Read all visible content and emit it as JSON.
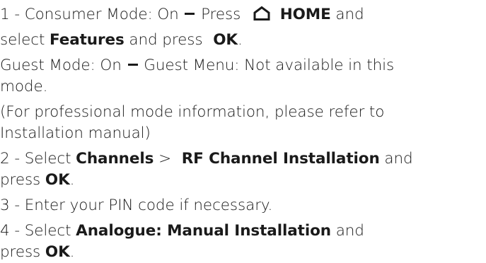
{
  "doc": {
    "l1": {
      "a": "1 - Consumer Mode: On",
      "b": "Press",
      "icon": "home-icon",
      "c": "HOME",
      "d": "and"
    },
    "l2": {
      "a": "select",
      "b": "Features",
      "c": "and press",
      "d": "OK",
      "e": "."
    },
    "l3": {
      "a": "Guest Mode: On",
      "b": "Guest Menu: Not available in this"
    },
    "l4": {
      "a": "mode."
    },
    "l5": {
      "a": "(For professional mode information, please refer to"
    },
    "l6": {
      "a": "Installation manual)"
    },
    "l7": {
      "a": "2 - Select",
      "b": "Channels",
      "c": ">",
      "d": "RF Channel Installation",
      "e": "and"
    },
    "l8": {
      "a": "press",
      "b": "OK",
      "c": "."
    },
    "l9": {
      "a": "3 - Enter your PIN code if necessary."
    },
    "l10": {
      "a": "4 - Select",
      "b": "Analogue: Manual Installation",
      "c": "and"
    },
    "l11": {
      "a": "press",
      "b": "OK",
      "c": "."
    }
  }
}
